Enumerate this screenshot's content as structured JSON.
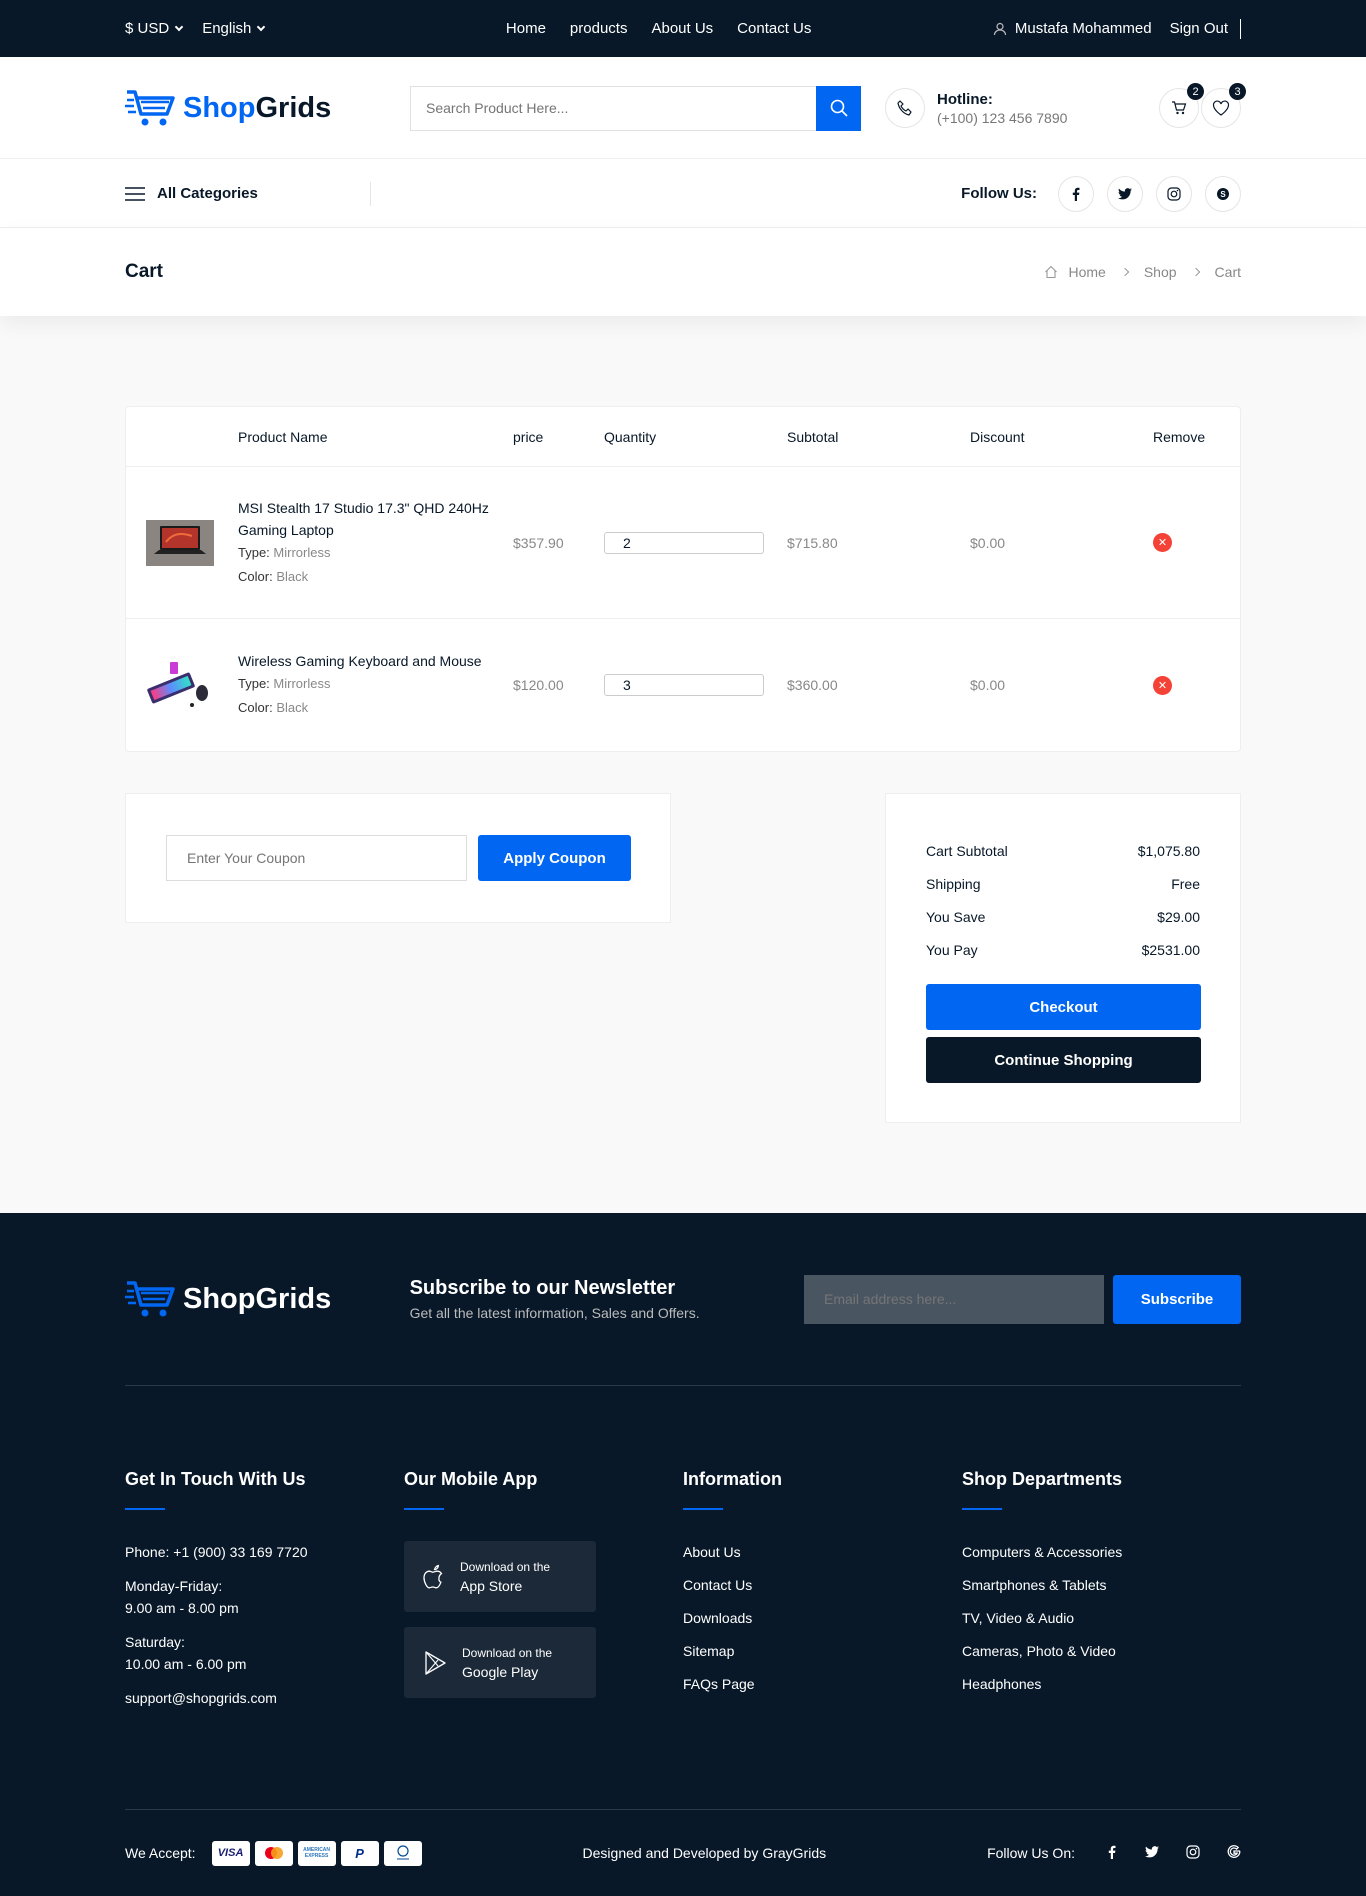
{
  "topbar": {
    "currency": "$ USD",
    "language": "English",
    "nav": [
      "Home",
      "products",
      "About Us",
      "Contact Us"
    ],
    "user": "Mustafa Mohammed",
    "signout": "Sign Out"
  },
  "header": {
    "logo_part1": "Shop",
    "logo_part2": "Grids",
    "search_placeholder": "Search Product Here...",
    "hotline_label": "Hotline:",
    "hotline_number": "(+100) 123 456 7890",
    "cart_count": "2",
    "wishlist_count": "3"
  },
  "catbar": {
    "all_categories": "All Categories",
    "follow_us": "Follow Us:"
  },
  "breadcrumb": {
    "title": "Cart",
    "items": [
      "Home",
      "Shop",
      "Cart"
    ]
  },
  "cart": {
    "headers": [
      "Product Name",
      "price",
      "Quantity",
      "Subtotal",
      "Discount",
      "Remove"
    ],
    "items": [
      {
        "name": "MSI Stealth 17 Studio 17.3\" QHD 240Hz Gaming Laptop",
        "type_label": "Type:",
        "type": "Mirrorless",
        "color_label": "Color:",
        "color": "Black",
        "price": "$357.90",
        "quantity": "2",
        "subtotal": "$715.80",
        "discount": "$0.00"
      },
      {
        "name": "Wireless Gaming Keyboard and Mouse",
        "type_label": "Type:",
        "type": "Mirrorless",
        "color_label": "Color:",
        "color": "Black",
        "price": "$120.00",
        "quantity": "3",
        "subtotal": "$360.00",
        "discount": "$0.00"
      }
    ]
  },
  "coupon": {
    "placeholder": "Enter Your Coupon",
    "button": "Apply Coupon"
  },
  "summary": {
    "rows": [
      {
        "label": "Cart Subtotal",
        "value": "$1,075.80"
      },
      {
        "label": "Shipping",
        "value": "Free"
      },
      {
        "label": "You Save",
        "value": "$29.00"
      },
      {
        "label": "You Pay",
        "value": "$2531.00"
      }
    ],
    "checkout": "Checkout",
    "continue": "Continue Shopping"
  },
  "footer": {
    "logo": "ShopGrids",
    "newsletter_title": "Subscribe to our Newsletter",
    "newsletter_sub": "Get all the latest information, Sales and Offers.",
    "email_placeholder": "Email address here...",
    "subscribe": "Subscribe",
    "contact_title": "Get In Touch With Us",
    "phone": "Phone: +1 (900) 33 169 7720",
    "weekday_label": "Monday-Friday:",
    "weekday_hours": "9.00 am - 8.00 pm",
    "saturday_label": "Saturday:",
    "saturday_hours": "10.00 am - 6.00 pm",
    "email": "support@shopgrids.com",
    "app_title": "Our Mobile App",
    "app_store_small": "Download on the",
    "app_store": "App Store",
    "google_small": "Download on the",
    "google": "Google Play",
    "info_title": "Information",
    "info_links": [
      "About Us",
      "Contact Us",
      "Downloads",
      "Sitemap",
      "FAQs Page"
    ],
    "dept_title": "Shop Departments",
    "dept_links": [
      "Computers & Accessories",
      "Smartphones & Tablets",
      "TV, Video & Audio",
      "Cameras, Photo & Video",
      "Headphones"
    ],
    "we_accept": "We Accept:",
    "credit": "Designed and Developed by GrayGrids",
    "follow_on": "Follow Us On:"
  },
  "colors": {
    "accent": "#0167f3",
    "dark": "#081828",
    "danger": "#f44336",
    "page_bg": "#f9f9f9"
  }
}
